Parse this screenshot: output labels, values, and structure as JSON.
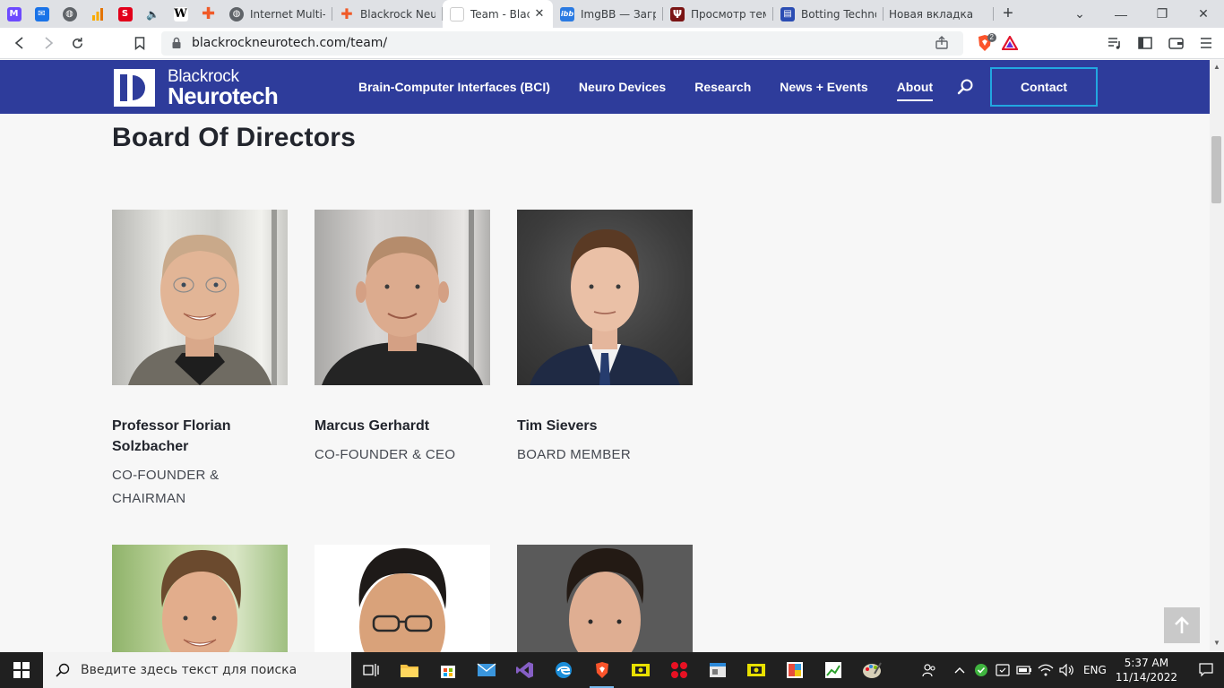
{
  "browser": {
    "tabs": [
      {
        "title": "Internet Multi-S",
        "favicon": "globe-icon"
      },
      {
        "title": "Blackrock Neuro",
        "favicon": "plus-cross-icon"
      },
      {
        "title": "Team - Blackrock",
        "favicon": "blackrock-icon",
        "active": true
      },
      {
        "title": "ImgBB — Загру",
        "favicon": "imgbb-icon"
      },
      {
        "title": "Просмотр темы",
        "favicon": "psi-icon"
      },
      {
        "title": "Botting Technol",
        "favicon": "window-icon"
      },
      {
        "title": "Новая вкладка",
        "favicon": ""
      }
    ],
    "new_tab_label": "+",
    "url": "blackrockneurotech.com/team/",
    "brave_badge": "2"
  },
  "site": {
    "logo_line1": "Blackrock",
    "logo_line2": "Neurotech",
    "nav": [
      {
        "label": "Brain-Computer Interfaces (BCI)"
      },
      {
        "label": "Neuro Devices"
      },
      {
        "label": "Research"
      },
      {
        "label": "News + Events"
      },
      {
        "label": "About",
        "current": true
      }
    ],
    "contact_label": "Contact",
    "brand_color": "#2e3c9b",
    "accent_color": "#22a7e0"
  },
  "board": {
    "title": "Board Of Directors",
    "members": [
      {
        "name": "Professor Florian Solzbacher",
        "role": "CO-FOUNDER & CHAIRMAN"
      },
      {
        "name": "Marcus Gerhardt",
        "role": "CO-FOUNDER & CEO"
      },
      {
        "name": "Tim Sievers",
        "role": "BOARD MEMBER"
      }
    ]
  },
  "taskbar": {
    "search_placeholder": "Введите здесь текст для поиска",
    "lang": "ENG",
    "time": "5:37 AM",
    "date": "11/14/2022"
  }
}
